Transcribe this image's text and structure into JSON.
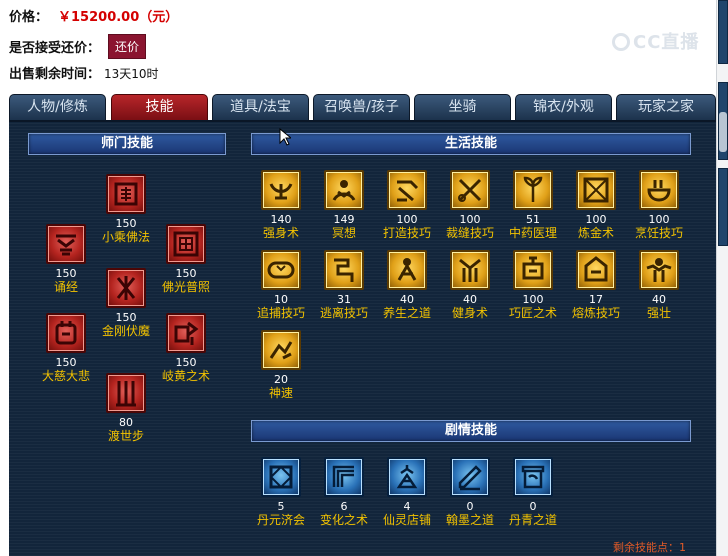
{
  "listing": {
    "price_label": "价格：",
    "price_value": "￥15200.00（元）",
    "bargain_label": "是否接受还价：",
    "bargain_badge": "还价",
    "time_label": "出售剩余时间：",
    "time_value": "13天10时"
  },
  "watermark": "CC直播",
  "tabs": [
    {
      "label": "人物/修炼"
    },
    {
      "label": "技能",
      "active": true
    },
    {
      "label": "道具/法宝"
    },
    {
      "label": "召唤兽/孩子"
    },
    {
      "label": "坐骑"
    },
    {
      "label": "锦衣/外观"
    },
    {
      "label": "玩家之家"
    }
  ],
  "school_skills": {
    "title": "师门技能",
    "items": [
      {
        "level": "150",
        "name": "小乘佛法",
        "icon": "buddhist-sutra-icon"
      },
      {
        "level": "150",
        "name": "诵经",
        "icon": "chanting-icon"
      },
      {
        "level": "150",
        "name": "佛光普照",
        "icon": "buddha-light-icon"
      },
      {
        "level": "150",
        "name": "金刚伏魔",
        "icon": "vajra-icon"
      },
      {
        "level": "150",
        "name": "大慈大悲",
        "icon": "compassion-icon"
      },
      {
        "level": "150",
        "name": "岐黄之术",
        "icon": "medicine-art-icon"
      },
      {
        "level": "80",
        "name": "渡世步",
        "icon": "footwork-icon"
      }
    ]
  },
  "life_skills": {
    "title": "生活技能",
    "items": [
      {
        "level": "140",
        "name": "强身术",
        "icon": "strengthen-icon"
      },
      {
        "level": "149",
        "name": "冥想",
        "icon": "meditation-icon"
      },
      {
        "level": "100",
        "name": "打造技巧",
        "icon": "forging-icon"
      },
      {
        "level": "100",
        "name": "裁缝技巧",
        "icon": "tailoring-icon"
      },
      {
        "level": "51",
        "name": "中药医理",
        "icon": "herbal-medicine-icon"
      },
      {
        "level": "100",
        "name": "炼金术",
        "icon": "alchemy-icon"
      },
      {
        "level": "100",
        "name": "烹饪技巧",
        "icon": "cooking-icon"
      },
      {
        "level": "10",
        "name": "追捕技巧",
        "icon": "pursuit-icon"
      },
      {
        "level": "31",
        "name": "逃离技巧",
        "icon": "escape-icon"
      },
      {
        "level": "40",
        "name": "养生之道",
        "icon": "health-icon"
      },
      {
        "level": "40",
        "name": "健身术",
        "icon": "fitness-icon"
      },
      {
        "level": "100",
        "name": "巧匠之术",
        "icon": "craftsman-icon"
      },
      {
        "level": "17",
        "name": "熔炼技巧",
        "icon": "smelting-icon"
      },
      {
        "level": "40",
        "name": "强壮",
        "icon": "strong-icon"
      },
      {
        "level": "20",
        "name": "神速",
        "icon": "speed-icon"
      }
    ]
  },
  "plot_skills": {
    "title": "剧情技能",
    "items": [
      {
        "level": "5",
        "name": "丹元济会",
        "icon": "elixir-icon"
      },
      {
        "level": "6",
        "name": "变化之术",
        "icon": "transformation-icon"
      },
      {
        "level": "4",
        "name": "仙灵店铺",
        "icon": "shop-icon"
      },
      {
        "level": "0",
        "name": "翰墨之道",
        "icon": "ink-icon"
      },
      {
        "level": "0",
        "name": "丹青之道",
        "icon": "painting-icon"
      }
    ]
  },
  "remaining_points": "剩余技能点：1"
}
